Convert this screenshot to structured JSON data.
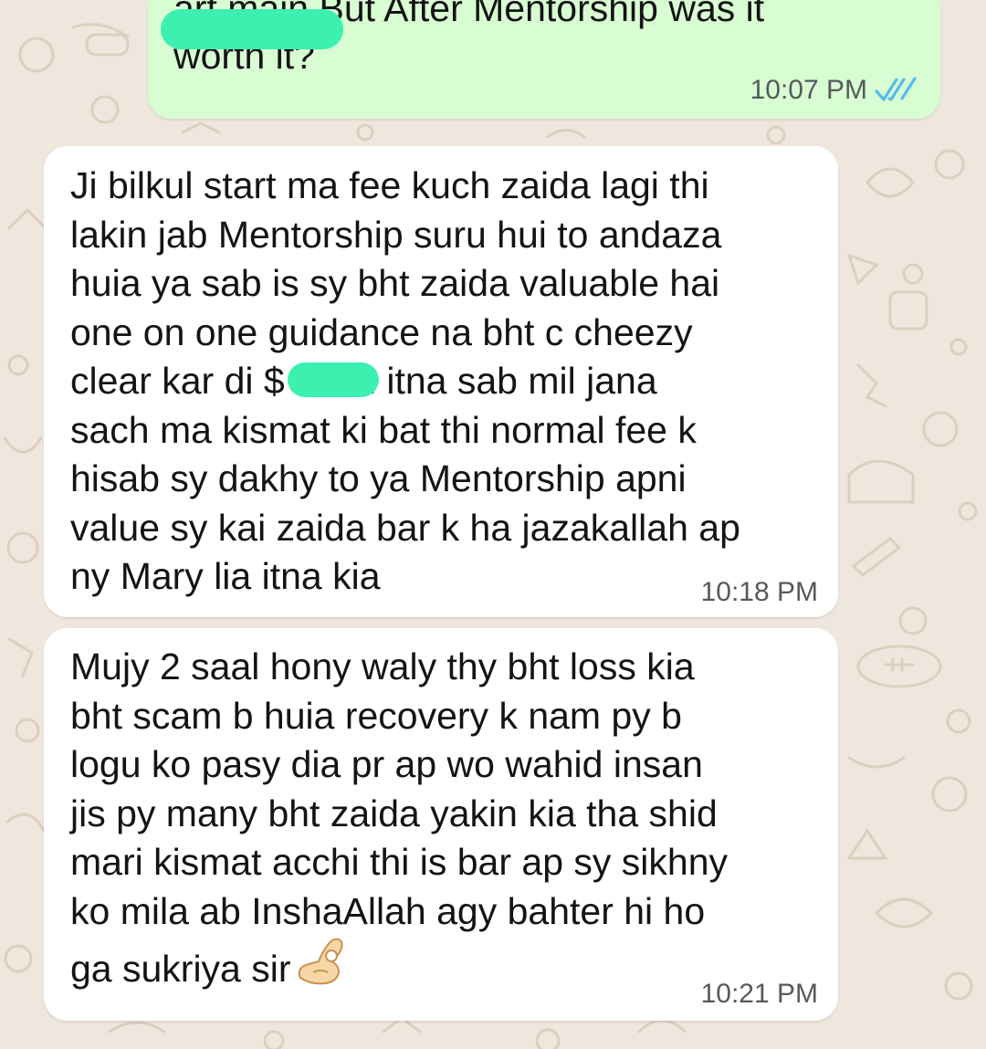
{
  "chat": {
    "messages": [
      {
        "direction": "outgoing",
        "text": "art main But After Mentorship was it\nworth it?",
        "time": "10:07 PM",
        "status_icon": "double-check-read-icon"
      },
      {
        "direction": "incoming",
        "text": "Ji  bilkul  start ma fee kuch zaida lagi thi\nlakin jab Mentorship suru hui to andaza\nhuia ya sab is sy bht zaida valuable hai\none on one guidance  na bht c cheezy\nclear kar di       $ main itna sab mil jana\nsach ma kismat ki bat thi normal fee k\nhisab sy dakhy to ya Mentorship  apni\nvalue sy kai zaida bar k ha jazakallah ap\nny Mary lia itna kia",
        "time": "10:18 PM"
      },
      {
        "direction": "incoming",
        "text": "Mujy 2 saal hony waly thy bht loss kia\nbht scam b huia recovery k nam py b\nlogu ko pasy dia pr ap wo wahid insan\njis py many bht zaida yakin kia tha shid\nmari kismat acchi thi is bar ap sy sikhny\nko mila ab InshaAllah agy bahter hi ho\nga sukriya sir",
        "time": "10:21 PM",
        "trailing_emoji": "ok-hand-emoji"
      }
    ]
  },
  "colors": {
    "chat_background": "#efe7dd",
    "outgoing_bubble": "#d9fdd3",
    "incoming_bubble": "#ffffff",
    "read_tick": "#53bdeb",
    "redaction": "#3cf0b0"
  }
}
